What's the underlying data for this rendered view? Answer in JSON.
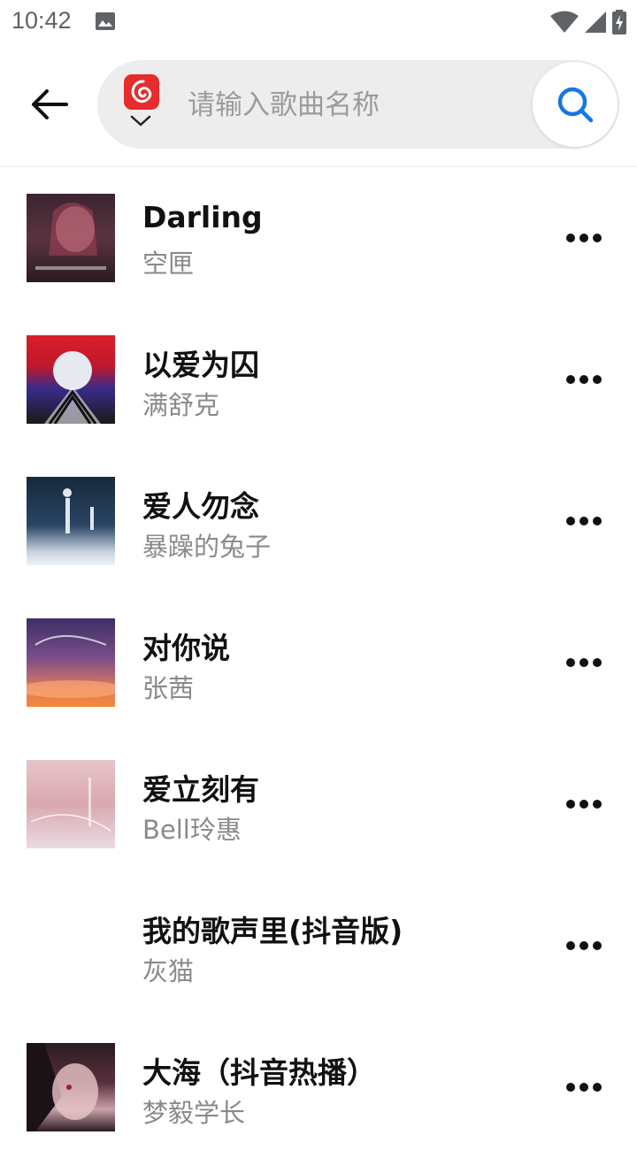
{
  "status_bar": {
    "time": "10:42"
  },
  "search": {
    "placeholder": "请输入歌曲名称",
    "value": ""
  },
  "songs": [
    {
      "title": "Darling",
      "artist": "空匣"
    },
    {
      "title": "以爱为囚",
      "artist": "满舒克"
    },
    {
      "title": "爱人勿念",
      "artist": "暴躁的兔子"
    },
    {
      "title": "对你说",
      "artist": "张茜"
    },
    {
      "title": "爱立刻有",
      "artist": "Bell玲惠"
    },
    {
      "title": "我的歌声里(抖音版)",
      "artist": "灰猫"
    },
    {
      "title": "大海（抖音热播）",
      "artist": "梦毅学长"
    }
  ],
  "colors": {
    "accent": "#1677e6",
    "source_logo": "#e62c2c",
    "search_bg": "#ededed"
  },
  "icons": {
    "back": "arrow-left",
    "search": "magnifier",
    "source": "netease-cloud-music",
    "more": "ellipsis"
  }
}
